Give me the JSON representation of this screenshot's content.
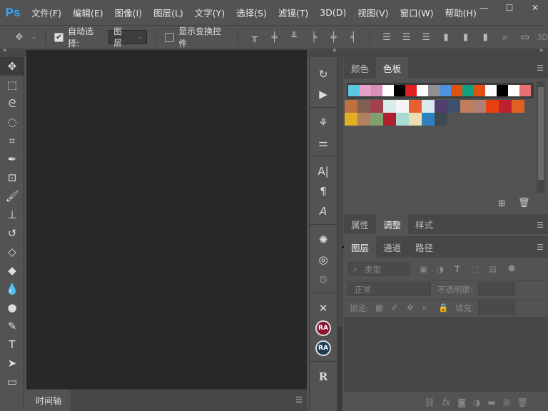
{
  "app": {
    "logo": "Ps"
  },
  "menu": [
    "文件(F)",
    "编辑(E)",
    "图像(I)",
    "图层(L)",
    "文字(Y)",
    "选择(S)",
    "滤镜(T)",
    "3D(D)",
    "视图(V)",
    "窗口(W)",
    "帮助(H)"
  ],
  "window_controls": [
    "—",
    "☐",
    "✕"
  ],
  "options": {
    "auto_select_label": "自动选择:",
    "auto_select_checked": true,
    "auto_select_target": "图层",
    "show_transform_label": "显示变换控件",
    "show_transform_checked": false,
    "mode_3d": "3D"
  },
  "timeline": {
    "tab": "时间轴"
  },
  "color_panel": {
    "tabs": [
      "颜色",
      "色板"
    ],
    "active": "色板",
    "swatches": [
      [
        "#5bc8e0",
        "#e8a0c8",
        "#d890b8",
        "#ffffff",
        "#000000",
        "#e02020",
        "#ffffff",
        "#909090",
        "#5090e0",
        "#e05010",
        "#10a080",
        "#e05010",
        "#ffffff",
        "#000000",
        "#ffffff",
        "#e87070"
      ],
      [
        "#c07040",
        "#806050",
        "#a04050",
        "#d8eeea",
        "#f4f4f4",
        "#e86030",
        "#d8eaf0",
        "#504070",
        "#405070",
        "#c08060",
        "#b08070",
        "#e84010",
        "#c02030",
        "#e06020"
      ],
      [
        "#e0b020",
        "#b08060",
        "#80a070",
        "#b02030",
        "#a8dcd0",
        "#ecdcb0",
        "#3080c0",
        "#404850"
      ]
    ]
  },
  "adjust_panel": {
    "tabs": [
      "属性",
      "调整",
      "样式"
    ],
    "active": "调整"
  },
  "layers_panel": {
    "tabs": [
      "图层",
      "通道",
      "路径"
    ],
    "active": "图层",
    "filter_placeholder": "类型",
    "blend_mode": "正常",
    "opacity_label": "不透明度:",
    "lock_label": "锁定:",
    "fill_label": "填充:"
  },
  "mid_icons": {
    "ra1": "RA",
    "ra2": "RA",
    "rpro": "R"
  }
}
